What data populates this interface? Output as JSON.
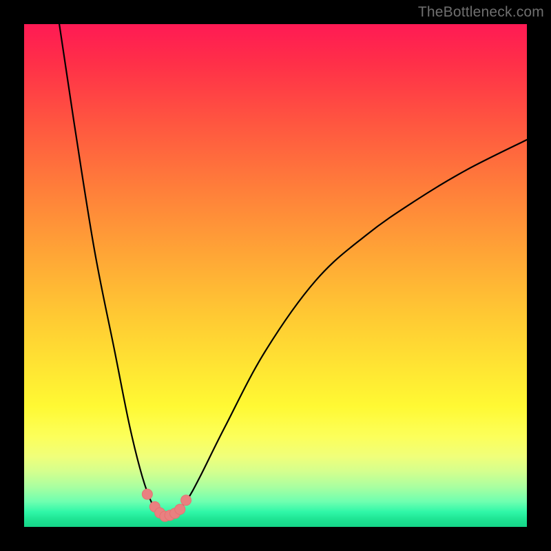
{
  "watermark": {
    "text": "TheBottleneck.com"
  },
  "colors": {
    "background": "#000000",
    "curve_stroke": "#000000",
    "marker_fill": "#e98080",
    "marker_stroke": "#e47272"
  },
  "chart_data": {
    "type": "line",
    "title": "",
    "xlabel": "",
    "ylabel": "",
    "xlim": [
      0,
      100
    ],
    "ylim": [
      0,
      100
    ],
    "grid": false,
    "legend": false,
    "series": [
      {
        "name": "left-branch",
        "x": [
          7,
          10,
          14,
          18,
          21,
          23.5,
          25.5,
          27,
          28
        ],
        "y": [
          100,
          80,
          55,
          35,
          20,
          10,
          4.5,
          2.5,
          2
        ]
      },
      {
        "name": "right-branch",
        "x": [
          28,
          29,
          30.5,
          32.5,
          35,
          40,
          48,
          58,
          68,
          78,
          88,
          100
        ],
        "y": [
          2,
          2.3,
          3.2,
          5.5,
          10,
          20,
          35,
          49,
          58,
          65,
          71,
          77
        ]
      }
    ],
    "markers": {
      "name": "highlight-points",
      "x": [
        24.5,
        26,
        27,
        28,
        29,
        30,
        31,
        32.2
      ],
      "y": [
        6.5,
        4,
        2.8,
        2.1,
        2.3,
        2.7,
        3.5,
        5.3
      ]
    }
  }
}
